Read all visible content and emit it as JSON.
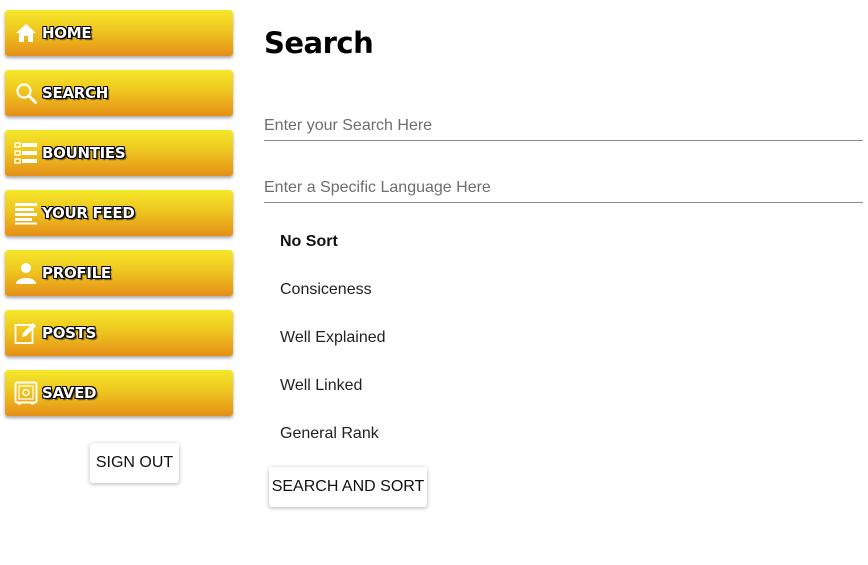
{
  "sidebar": {
    "items": [
      {
        "label": "HOME",
        "icon": "home-icon"
      },
      {
        "label": "SEARCH",
        "icon": "search-icon"
      },
      {
        "label": "BOUNTIES",
        "icon": "list-icon"
      },
      {
        "label": "YOUR FEED",
        "icon": "feed-icon"
      },
      {
        "label": "PROFILE",
        "icon": "person-icon"
      },
      {
        "label": "POSTS",
        "icon": "edit-icon"
      },
      {
        "label": "SAVED",
        "icon": "safe-icon"
      }
    ],
    "sign_out_label": "SIGN OUT"
  },
  "main": {
    "title": "Search",
    "search_field": {
      "placeholder": "Enter your Search Here",
      "value": ""
    },
    "language_field": {
      "placeholder": "Enter a Specific Language Here",
      "value": ""
    },
    "sort_options": [
      {
        "label": "No Sort",
        "selected": true
      },
      {
        "label": "Consiceness",
        "selected": false
      },
      {
        "label": "Well Explained",
        "selected": false
      },
      {
        "label": "Well Linked",
        "selected": false
      },
      {
        "label": "General Rank",
        "selected": false
      }
    ],
    "search_sort_label": "SEARCH AND SORT"
  },
  "colors": {
    "nav_gradient_top": "#f4e829",
    "nav_gradient_bottom": "#e58f17",
    "nav_text": "#ffffff"
  }
}
